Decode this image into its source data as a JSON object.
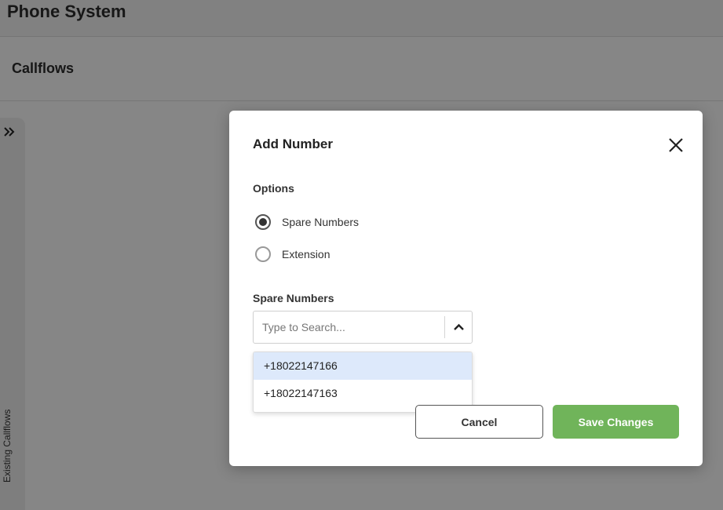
{
  "app": {
    "title": "Phone System",
    "section_title": "Callflows"
  },
  "side_panel": {
    "label": "Existing Callflows",
    "expand_icon": "double-chevron-right-icon"
  },
  "modal": {
    "title": "Add Number",
    "close_icon": "close-icon",
    "options_label": "Options",
    "options": [
      {
        "label": "Spare Numbers",
        "selected": true
      },
      {
        "label": "Extension",
        "selected": false
      }
    ],
    "spare_numbers_label": "Spare Numbers",
    "search": {
      "placeholder": "Type to Search...",
      "value": "",
      "toggle_icon": "chevron-up-icon"
    },
    "dropdown_items": [
      {
        "label": "+18022147166",
        "highlighted": true
      },
      {
        "label": "+18022147163",
        "highlighted": false
      }
    ],
    "buttons": {
      "cancel_label": "Cancel",
      "save_label": "Save Changes"
    }
  },
  "colors": {
    "accent_green": "#70b45a",
    "highlight_blue": "#dde9fb",
    "overlay": "rgba(0,0,0,0.45)"
  }
}
